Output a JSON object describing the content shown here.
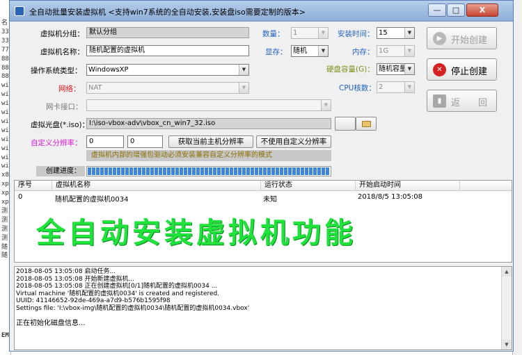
{
  "background_app": {
    "left_lines": [
      "名",
      "33",
      "33",
      "77",
      "88",
      "88",
      "88",
      "wi",
      "wi",
      "wi",
      "wi",
      "wi",
      "wi",
      "wi",
      "wi",
      "wi",
      "wi",
      "x8",
      "xp",
      "xp",
      "xp",
      "测",
      "测",
      "测",
      "测",
      "随",
      "随"
    ],
    "left_bottom": "EM"
  },
  "window": {
    "title": "全自动批量安装虚拟机 <支持win7系统的全自动安装,安装盘iso需要定制的版本>",
    "controls": {
      "minimize": "—",
      "maximize": "□",
      "close": "X"
    }
  },
  "form": {
    "group_label": "虚拟机分组：",
    "group_value": "默认分组",
    "name_label": "虚拟机名称：",
    "name_value": "随机配置的虚拟机",
    "os_label": "操作系统类型：",
    "os_value": "WindowsXP",
    "network_label": "网络：",
    "network_value": "NAT",
    "nic_label": "网卡接口：",
    "nic_value": "",
    "iso_label": "虚拟光盘(*.iso)：",
    "iso_value": "I:\\iso-vbox-adv\\vbox_cn_win7_32.iso",
    "resolution_label": "自定义分辨率：",
    "res_width": "0",
    "res_height": "0",
    "get_resolution_button": "获取当前主机分辨率",
    "no_custom_resolution_button": "不使用自定义分辨率",
    "info_text": "虚拟机内部的增强包驱动必须安装兼容自定义分辨率的模式",
    "progress_label": "创建进度：",
    "progress_percent": 100,
    "count_label": "数量：",
    "count_value": "1",
    "install_time_label": "安装时间：",
    "install_time_value": "15",
    "display_label": "显存：",
    "display_value": "随机",
    "memory_label": "内存：",
    "memory_value": "1G",
    "disk_label": "硬盘容量(G)：",
    "disk_value": "随机容量",
    "cpu_label": "CPU核数：",
    "cpu_value": "2"
  },
  "buttons": {
    "start": "开始创建",
    "stop": "停止创建",
    "back": "返　　回"
  },
  "table": {
    "columns": [
      "序号",
      "虚拟机名称",
      "运行状态",
      "开始启动时间"
    ],
    "rows": [
      {
        "index": "0",
        "name": "随机配置的虚拟机0034",
        "status": "未知",
        "start_time": "2018/8/5 13:05:08"
      }
    ]
  },
  "overlay_text": "全自动安装虚拟机功能",
  "log": [
    "2018-08-05 13:05:08 启动任务...",
    "2018-08-05 13:05:08 开始新建虚拟机...",
    "2018-08-05 13:05:08 正在创建虚拟机[0/1]随机配置的虚拟机0034 ...",
    "Virtual machine '随机配置的虚拟机0034' is created and registered.",
    "UUID: 41146652-92de-469a-a7d9-b576b1595f98",
    "Settings file: 'I:\\vbox-img\\随机配置的虚拟机0034\\随机配置的虚拟机0034.vbox'",
    "",
    "  正在初始化磁盘信息..."
  ],
  "colors": {
    "overlay": "#1fe33a",
    "progress": "#3e86dd",
    "label_blue": "#1f5fbf",
    "label_red": "#e0151e",
    "label_magenta": "#d518d5"
  }
}
